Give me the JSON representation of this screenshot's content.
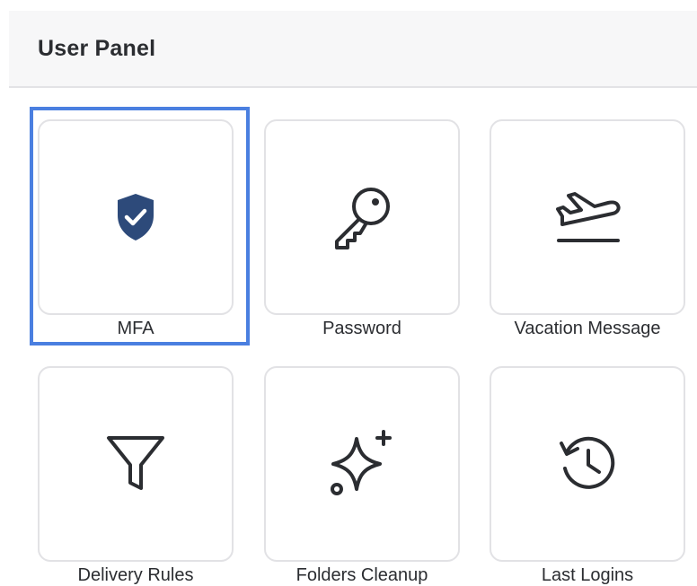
{
  "header": {
    "title": "User Panel"
  },
  "tiles": [
    {
      "label": "MFA",
      "icon": "shield-check-icon",
      "selected": true
    },
    {
      "label": "Password",
      "icon": "key-icon",
      "selected": false
    },
    {
      "label": "Vacation Message",
      "icon": "airplane-takeoff-icon",
      "selected": false
    },
    {
      "label": "Delivery Rules",
      "icon": "filter-icon",
      "selected": false
    },
    {
      "label": "Folders Cleanup",
      "icon": "sparkles-icon",
      "selected": false
    },
    {
      "label": "Last Logins",
      "icon": "history-clock-icon",
      "selected": false
    }
  ],
  "colors": {
    "selection": "#4a7fe0",
    "shield": "#2d4a7a",
    "icon_stroke": "#2b2d31"
  }
}
